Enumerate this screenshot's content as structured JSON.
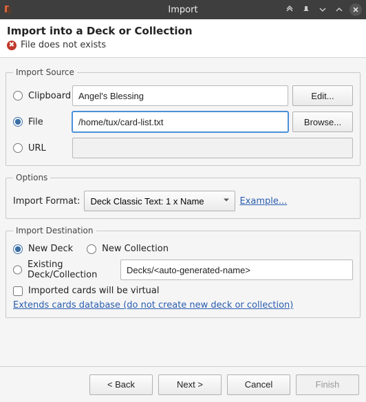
{
  "window": {
    "title": "Import"
  },
  "header": {
    "heading": "Import into a Deck or Collection",
    "error": "File does not exists"
  },
  "source": {
    "legend": "Import Source",
    "clipboard_label": "Clipboard",
    "clipboard_value": "Angel's Blessing",
    "file_label": "File",
    "file_value": "/home/tux/card-list.txt",
    "url_label": "URL",
    "url_value": "",
    "edit_btn": "Edit...",
    "browse_btn": "Browse...",
    "selected": "file"
  },
  "options": {
    "legend": "Options",
    "format_label": "Import Format:",
    "format_value": "Deck Classic Text: 1 x Name",
    "example_link": "Example..."
  },
  "destination": {
    "legend": "Import Destination",
    "new_deck": "New Deck",
    "new_collection": "New Collection",
    "existing_label": "Existing Deck/Collection",
    "existing_value": "Decks/<auto-generated-name>",
    "virtual_label": "Imported cards will be virtual",
    "virtual_checked": false,
    "extends_link": "Extends cards database (do not create new deck or collection)",
    "selected": "new_deck"
  },
  "footer": {
    "back": "< Back",
    "next": "Next >",
    "cancel": "Cancel",
    "finish": "Finish"
  }
}
